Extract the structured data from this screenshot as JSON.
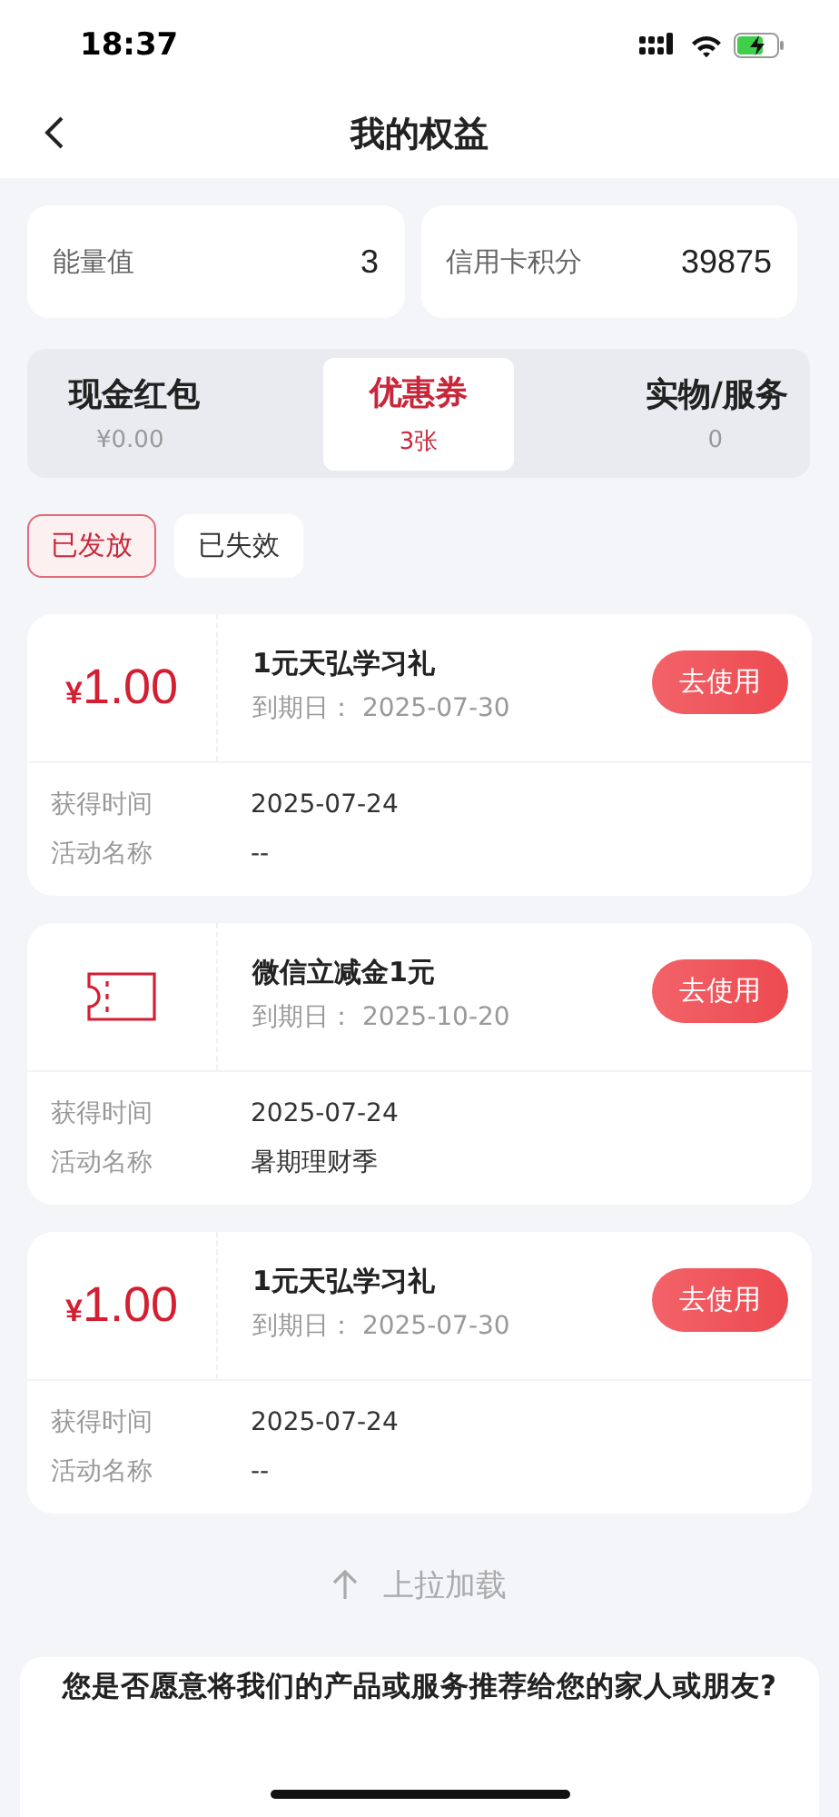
{
  "status_bar": {
    "time": "18:37"
  },
  "header": {
    "title": "我的权益"
  },
  "stats": [
    {
      "label": "能量值",
      "value": "3"
    },
    {
      "label": "信用卡积分",
      "value": "39875"
    }
  ],
  "tabs": [
    {
      "label": "现金红包",
      "sub": "¥0.00",
      "selected": false
    },
    {
      "label": "优惠券",
      "sub": "3张",
      "selected": true
    },
    {
      "label": "实物/服务",
      "sub": "0",
      "selected": false
    }
  ],
  "filters": [
    {
      "label": "已发放",
      "selected": true
    },
    {
      "label": "已失效",
      "selected": false
    }
  ],
  "coupons": [
    {
      "kind": "amount",
      "amount": "1.00",
      "currency": "¥",
      "title": "1元天弘学习礼",
      "expiry_label": "到期日：",
      "expiry": "2025-07-30",
      "button": "去使用",
      "rows": [
        {
          "label": "获得时间",
          "value": "2025-07-24"
        },
        {
          "label": "活动名称",
          "value": "--"
        }
      ]
    },
    {
      "kind": "ticket",
      "title": "微信立减金1元",
      "expiry_label": "到期日：",
      "expiry": "2025-10-20",
      "button": "去使用",
      "rows": [
        {
          "label": "获得时间",
          "value": "2025-07-24"
        },
        {
          "label": "活动名称",
          "value": "暑期理财季"
        }
      ]
    },
    {
      "kind": "amount",
      "amount": "1.00",
      "currency": "¥",
      "title": "1元天弘学习礼",
      "expiry_label": "到期日：",
      "expiry": "2025-07-30",
      "button": "去使用",
      "rows": [
        {
          "label": "获得时间",
          "value": "2025-07-24"
        },
        {
          "label": "活动名称",
          "value": "--"
        }
      ]
    }
  ],
  "load_more": "上拉加载",
  "survey": {
    "question": "您是否愿意将我们的产品或服务推荐给您的家人或朋友?"
  }
}
